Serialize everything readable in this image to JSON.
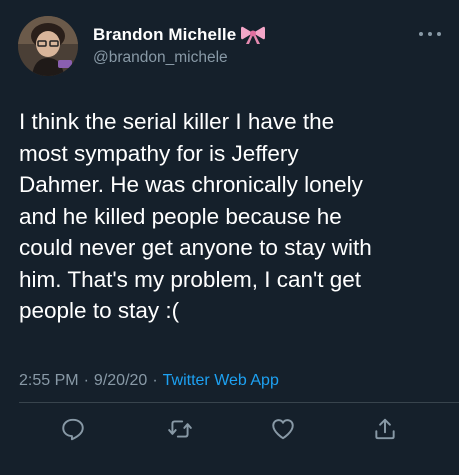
{
  "tweet": {
    "author": {
      "display_name": "Brandon Michelle",
      "name_emoji": "bow-emoji",
      "handle": "@brandon_michele",
      "avatar": "avatar"
    },
    "text_lines": [
      "I think the serial killer I have the",
      "most sympathy for is Jeffery",
      "Dahmer. He was chronically lonely",
      "and he killed people because he",
      "could never get anyone to stay with",
      "him. That's my problem, I can't get",
      "people to stay :("
    ],
    "time": "2:55 PM",
    "separator": "·",
    "date": "9/20/20",
    "source": "Twitter Web App"
  },
  "actions": {
    "reply": "reply-icon",
    "retweet": "retweet-icon",
    "like": "like-icon",
    "share": "share-icon"
  },
  "colors": {
    "background": "#15202b",
    "text": "#ffffff",
    "secondary": "#8899a6",
    "accent": "#1da1f2",
    "divider": "#38444d"
  }
}
